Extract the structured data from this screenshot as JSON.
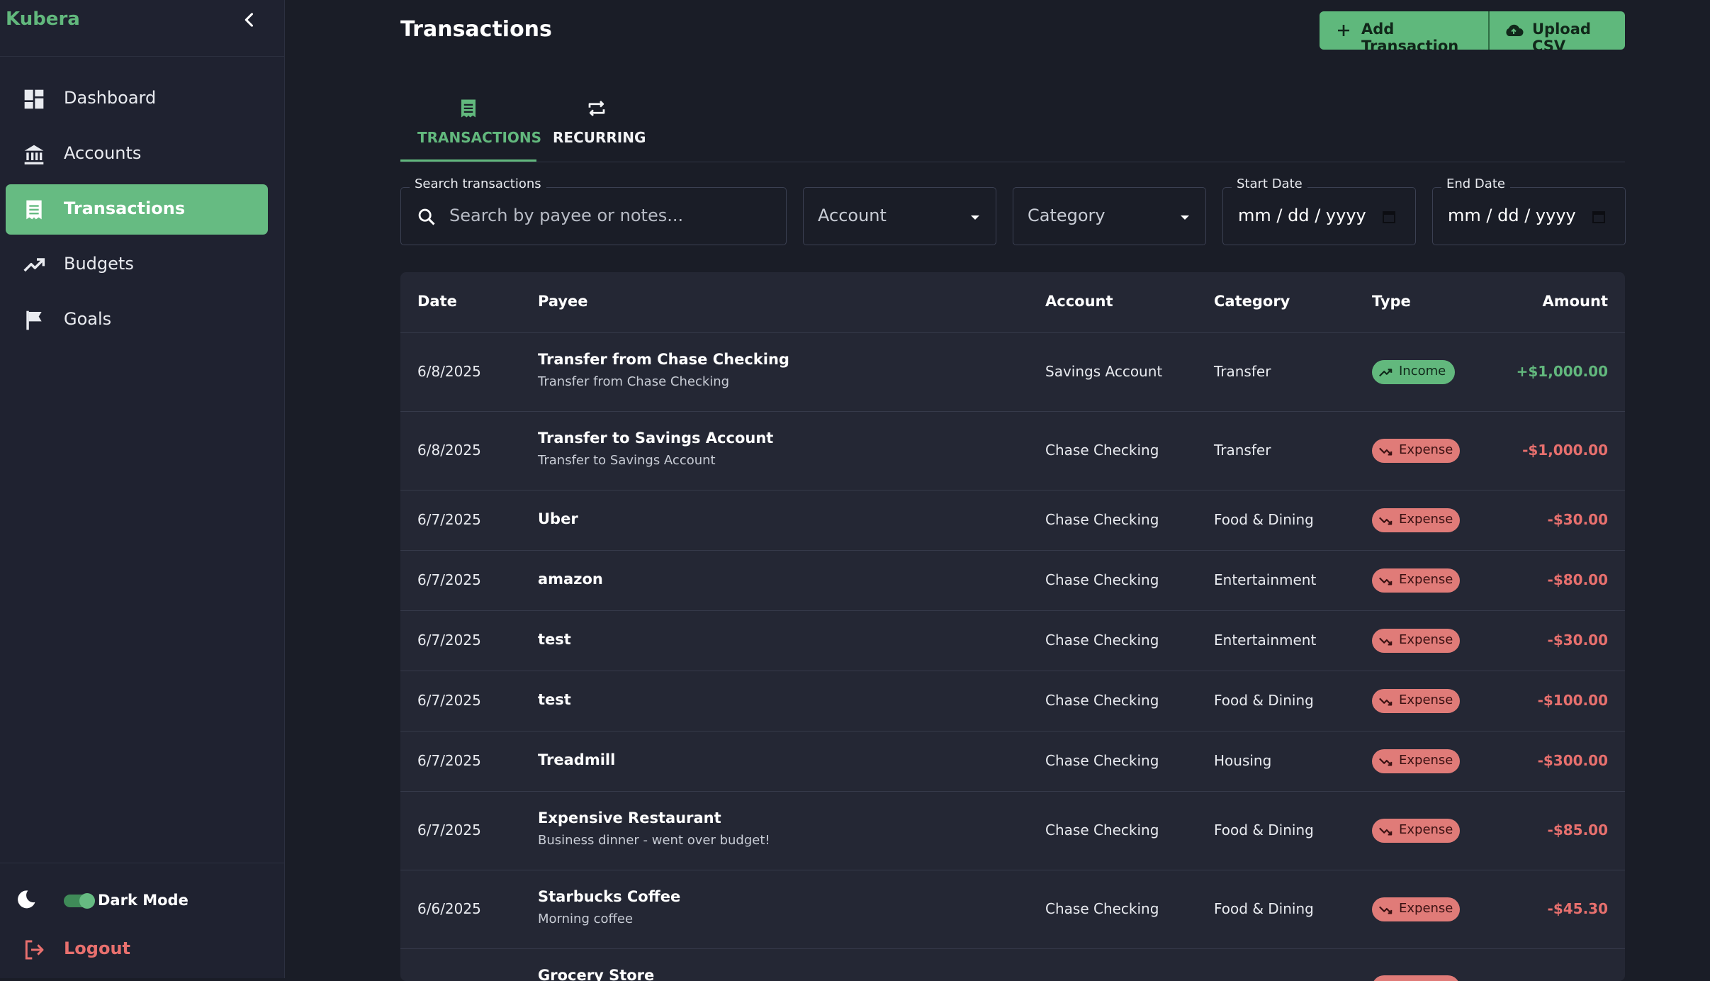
{
  "app": {
    "name": "Kubera"
  },
  "colors": {
    "accent": "#66bb82",
    "income": "#62b87d",
    "expense": "#e8706e",
    "background": "#1a1d27",
    "sidebar": "#1f2230"
  },
  "sidebar": {
    "items": [
      {
        "label": "Dashboard",
        "icon": "dashboard-icon"
      },
      {
        "label": "Accounts",
        "icon": "bank-icon"
      },
      {
        "label": "Transactions",
        "icon": "receipt-icon",
        "active": true
      },
      {
        "label": "Budgets",
        "icon": "trending-up-icon"
      },
      {
        "label": "Goals",
        "icon": "flag-icon"
      }
    ],
    "dark_mode_label": "Dark Mode",
    "dark_mode_on": true,
    "logout_label": "Logout"
  },
  "page": {
    "title": "Transactions",
    "add_button": "Add Transaction",
    "upload_button": "Upload CSV"
  },
  "tabs": [
    {
      "label": "TRANSACTIONS",
      "icon": "receipt-icon",
      "active": true
    },
    {
      "label": "RECURRING",
      "icon": "repeat-icon",
      "active": false
    }
  ],
  "filters": {
    "search_label": "Search transactions",
    "search_placeholder": "Search by payee or notes...",
    "account_value": "Account",
    "category_value": "Category",
    "start_label": "Start Date",
    "start_value": "mm / dd / yyyy",
    "end_label": "End Date",
    "end_value": "mm / dd / yyyy"
  },
  "table": {
    "headers": {
      "date": "Date",
      "payee": "Payee",
      "account": "Account",
      "category": "Category",
      "type": "Type",
      "amount": "Amount"
    },
    "rows": [
      {
        "date": "6/8/2025",
        "payee": "Transfer from Chase Checking",
        "note": "Transfer from Chase Checking",
        "account": "Savings Account",
        "category": "Transfer",
        "type": "Income",
        "amount": "+$1,000.00"
      },
      {
        "date": "6/8/2025",
        "payee": "Transfer to Savings Account",
        "note": "Transfer to Savings Account",
        "account": "Chase Checking",
        "category": "Transfer",
        "type": "Expense",
        "amount": "-$1,000.00"
      },
      {
        "date": "6/7/2025",
        "payee": "Uber",
        "note": "",
        "account": "Chase Checking",
        "category": "Food & Dining",
        "type": "Expense",
        "amount": "-$30.00"
      },
      {
        "date": "6/7/2025",
        "payee": "amazon",
        "note": "",
        "account": "Chase Checking",
        "category": "Entertainment",
        "type": "Expense",
        "amount": "-$80.00"
      },
      {
        "date": "6/7/2025",
        "payee": "test",
        "note": "",
        "account": "Chase Checking",
        "category": "Entertainment",
        "type": "Expense",
        "amount": "-$30.00"
      },
      {
        "date": "6/7/2025",
        "payee": "test",
        "note": "",
        "account": "Chase Checking",
        "category": "Food & Dining",
        "type": "Expense",
        "amount": "-$100.00"
      },
      {
        "date": "6/7/2025",
        "payee": "Treadmill",
        "note": "",
        "account": "Chase Checking",
        "category": "Housing",
        "type": "Expense",
        "amount": "-$300.00"
      },
      {
        "date": "6/7/2025",
        "payee": "Expensive Restaurant",
        "note": "Business dinner - went over budget!",
        "account": "Chase Checking",
        "category": "Food & Dining",
        "type": "Expense",
        "amount": "-$85.00"
      },
      {
        "date": "6/6/2025",
        "payee": "Starbucks Coffee",
        "note": "Morning coffee",
        "account": "Chase Checking",
        "category": "Food & Dining",
        "type": "Expense",
        "amount": "-$45.30"
      },
      {
        "date": "",
        "payee": "Grocery Store",
        "note": "",
        "account": "",
        "category": "",
        "type": "Expense",
        "amount": ""
      }
    ]
  }
}
